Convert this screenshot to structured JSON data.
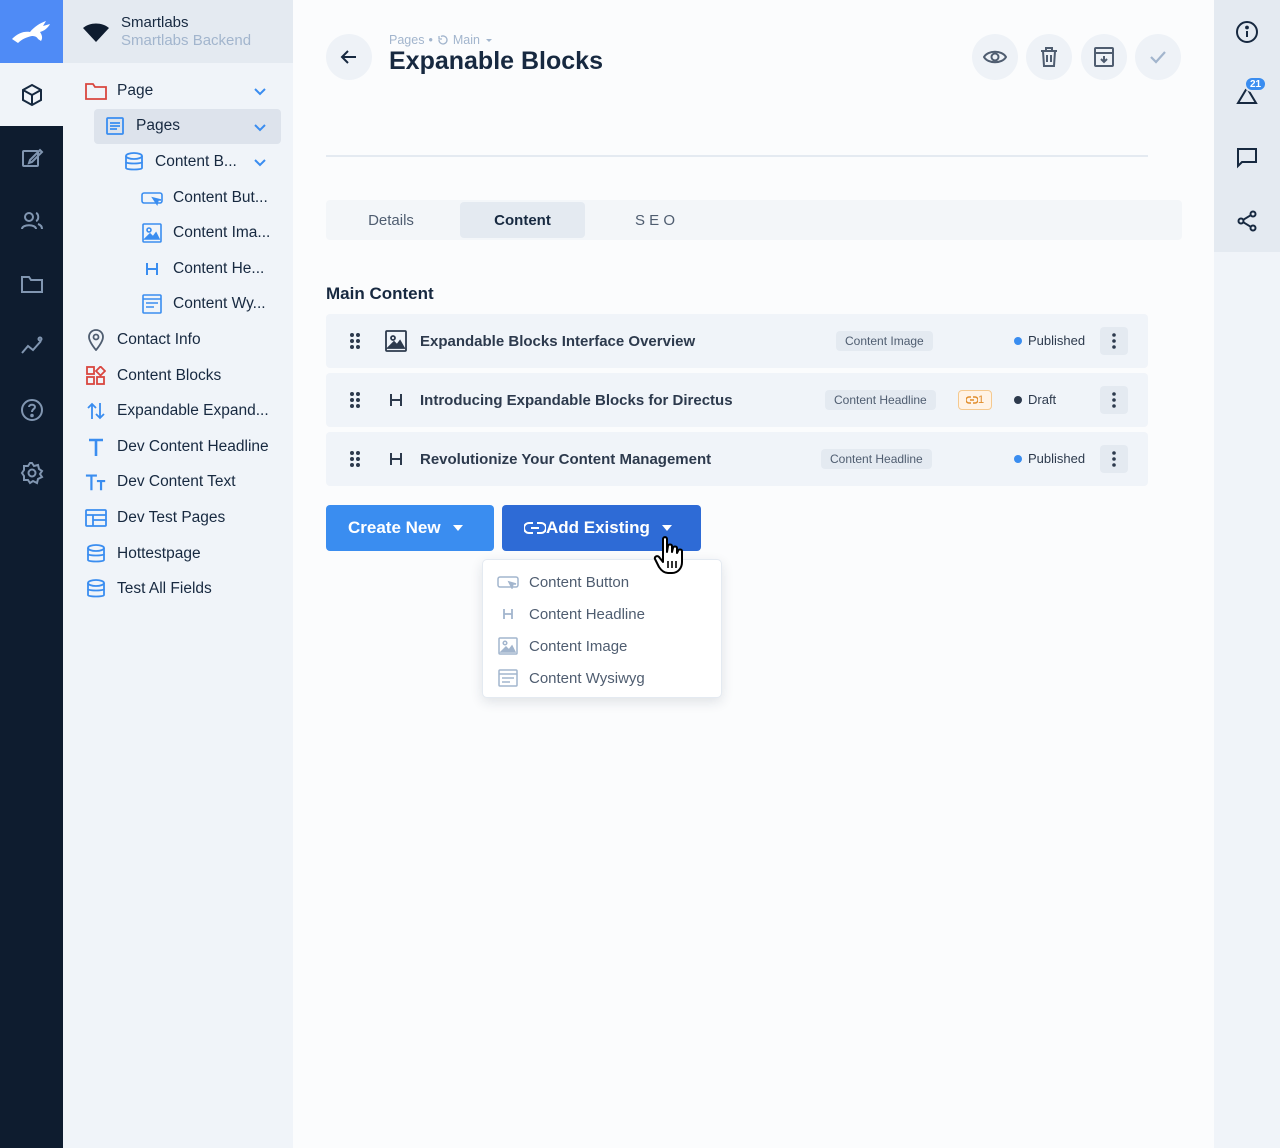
{
  "project": {
    "name": "Smartlabs",
    "subtitle": "Smartlabs Backend"
  },
  "nav": {
    "items": [
      {
        "label": "Page",
        "icon": "folder-icon",
        "level": 0,
        "expanded": true
      },
      {
        "label": "Pages",
        "icon": "document-icon",
        "level": 1,
        "expanded": true,
        "selected": true
      },
      {
        "label": "Content B...",
        "icon": "database-icon",
        "level": 2,
        "expanded": true
      },
      {
        "label": "Content But...",
        "icon": "button-icon",
        "level": 3
      },
      {
        "label": "Content Ima...",
        "icon": "image-icon",
        "level": 3
      },
      {
        "label": "Content He...",
        "icon": "heading-icon",
        "level": 3
      },
      {
        "label": "Content Wy...",
        "icon": "wysiwyg-icon",
        "level": 3
      },
      {
        "label": "Contact Info",
        "icon": "location-pin-icon",
        "level": 0
      },
      {
        "label": "Content Blocks",
        "icon": "widgets-icon",
        "level": 0
      },
      {
        "label": "Expandable Expand...",
        "icon": "sort-arrows-icon",
        "level": 0
      },
      {
        "label": "Dev Content Headline",
        "icon": "title-t-icon",
        "level": 0
      },
      {
        "label": "Dev Content Text",
        "icon": "text-fields-icon",
        "level": 0
      },
      {
        "label": "Dev Test Pages",
        "icon": "web-layout-icon",
        "level": 0
      },
      {
        "label": "Hottestpage",
        "icon": "database-icon",
        "level": 0
      },
      {
        "label": "Test All Fields",
        "icon": "database-icon",
        "level": 0
      }
    ]
  },
  "header": {
    "breadcrumb_root": "Pages",
    "breadcrumb_separator": "•",
    "breadcrumb_version": "Main",
    "title": "Expanable Blocks"
  },
  "tabs": [
    {
      "label": "Details",
      "active": false
    },
    {
      "label": "Content",
      "active": true
    },
    {
      "label": "S E O",
      "active": false
    }
  ],
  "main_content": {
    "title": "Main Content",
    "rows": [
      {
        "icon": "image-icon",
        "title": "Expandable Blocks Interface Overview",
        "type": "Content Image",
        "status": "Published",
        "link_count": null
      },
      {
        "icon": "heading-icon",
        "title": "Introducing Expandable Blocks for Directus",
        "type": "Content Headline",
        "status": "Draft",
        "link_count": "1"
      },
      {
        "icon": "heading-icon",
        "title": "Revolutionize Your Content Management",
        "type": "Content Headline",
        "status": "Published",
        "link_count": null
      }
    ]
  },
  "actions": {
    "create_new": "Create New",
    "add_existing": "Add Existing"
  },
  "dropdown": {
    "items": [
      {
        "label": "Content Button",
        "icon": "button-icon"
      },
      {
        "label": "Content Headline",
        "icon": "heading-icon"
      },
      {
        "label": "Content Image",
        "icon": "image-icon"
      },
      {
        "label": "Content Wysiwyg",
        "icon": "wysiwyg-icon"
      }
    ]
  },
  "right_sidebar": {
    "notification_count": "21"
  },
  "colors": {
    "primary": "#3a8df0",
    "primary_dark": "#2e6bd6",
    "module_bar": "#0e1c2f",
    "published_dot": "#3a8df0",
    "draft_dot": "#2d3a4d",
    "icon_red": "#d9463f"
  }
}
